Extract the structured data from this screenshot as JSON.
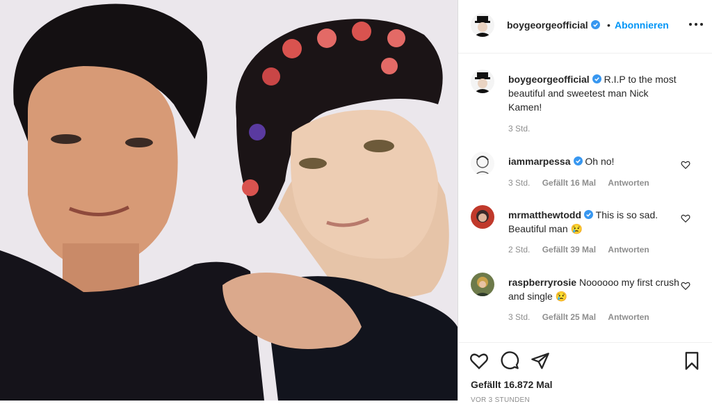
{
  "post": {
    "username": "boygeorgeofficial",
    "follow_label": "Abonnieren",
    "separator": "•",
    "caption": {
      "username": "boygeorgeofficial",
      "text": "R.I.P to the most beautiful and sweetest man Nick Kamen!",
      "time": "3 Std."
    }
  },
  "comments": [
    {
      "username": "iammarpessa",
      "text": "Oh no!",
      "time": "3 Std.",
      "likes": "Gefällt 16 Mal",
      "reply": "Antworten"
    },
    {
      "username": "mrmatthewtodd",
      "text": "This is so sad. Beautiful man 😢",
      "time": "2 Std.",
      "likes": "Gefällt 39 Mal",
      "reply": "Antworten"
    },
    {
      "username": "raspberryrosie",
      "text": "Noooooo my first crush and single 😢",
      "time": "3 Std.",
      "likes": "Gefällt 25 Mal",
      "reply": "Antworten"
    }
  ],
  "footer": {
    "likes_total": "Gefällt 16.872 Mal",
    "time_ago": "VOR 3 STUNDEN"
  },
  "icons": [
    "verified-icon",
    "more-icon",
    "heart-icon",
    "comment-icon",
    "share-icon",
    "bookmark-icon"
  ],
  "colors": {
    "accent": "#0095f6",
    "text": "#262626",
    "muted": "#8e8e8e",
    "verified": "#3897f0"
  }
}
